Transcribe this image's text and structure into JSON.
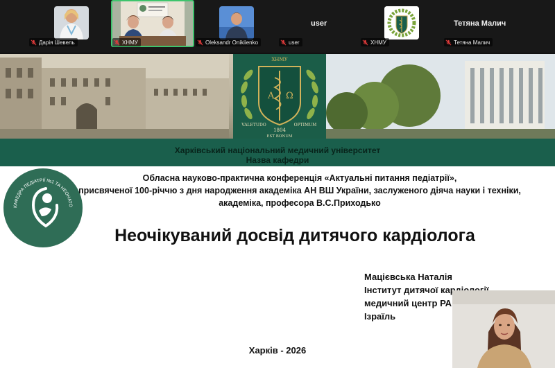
{
  "participants": [
    {
      "name": "Дарія Шевель",
      "has_video": true
    },
    {
      "name": "ХНМУ",
      "has_video": true,
      "active_speaker": true
    },
    {
      "name": "Oleksandr Onikiienko",
      "has_video": true
    },
    {
      "name": "user",
      "has_video": false,
      "display_text": "user"
    },
    {
      "name": "ХНМУ",
      "has_video": true
    },
    {
      "name": "Тетяна Малич",
      "has_video": false,
      "display_text": "Тетяна Малич"
    }
  ],
  "mic_icon": "mic-off-icon",
  "colors": {
    "banner_green": "#1a5f4c",
    "active_border": "#3ec46d",
    "mic_off": "#e03b3b"
  },
  "slide": {
    "emblem": {
      "top_text": "ХНМУ",
      "left_letter": "Α",
      "right_letter": "Ω",
      "motto_left": "VALETUDO",
      "motto_right": "OPTIMUM",
      "year": "1804",
      "bottom_text": "EST BONUM"
    },
    "university": "Харківський національний медичний університет",
    "department": "Назва кафедри",
    "logo_text": "КАФЕДРА ПЕДІАТРІЇ №1 ТА НЕОНАТОЛОГІЇ ХНМУ",
    "conference_lines": [
      "Обласна науково-практична конференція «Актуальні питання педіатрії»,",
      "присвяченої 100-річчю з дня народження академіка АН ВШ України, заслуженого діяча науки і техніки,",
      "академіка, професора В.С.Приходько"
    ],
    "title": "Неочікуваний досвід дитячого кардіолога",
    "author_lines": [
      "Мацієвська Наталія",
      "Інститут дитячої кардіології",
      "медичний центр РА",
      "Ізраїль"
    ],
    "city_year": "Харків - 2026"
  }
}
